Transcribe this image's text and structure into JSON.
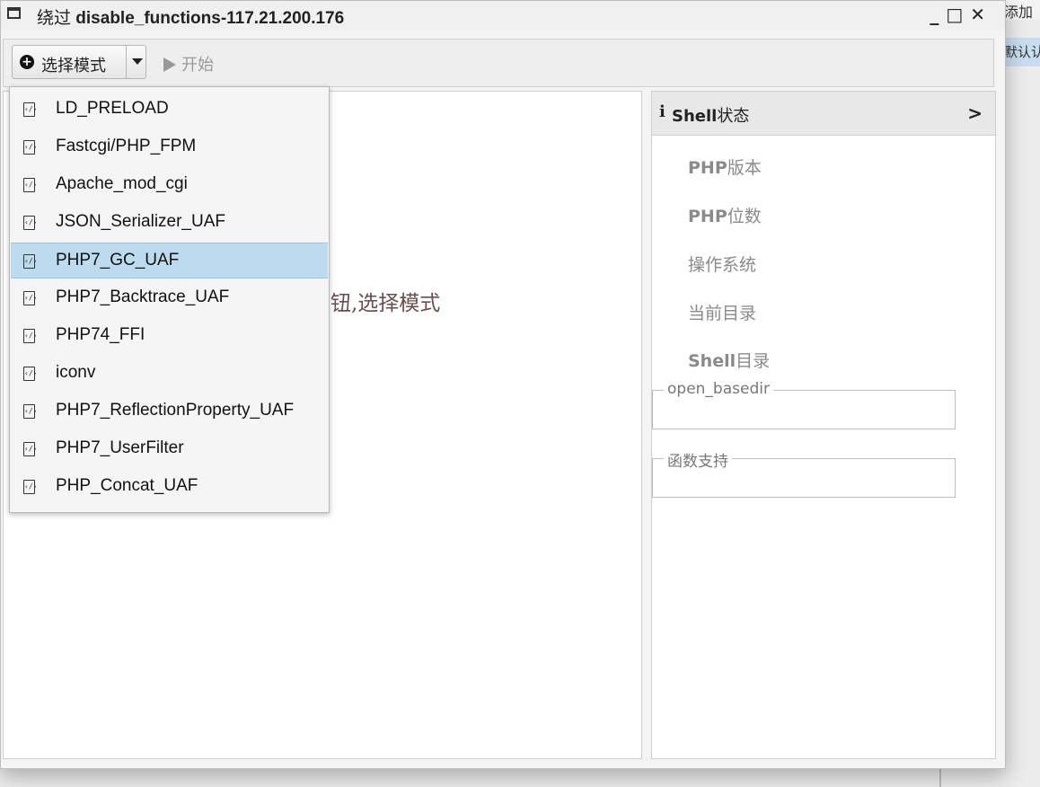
{
  "background": {
    "top_right_text": "添加",
    "tab_text": "默认认"
  },
  "window": {
    "title_prefix": "绕过",
    "title_highlight": "disable_functions-117.21.200.176",
    "controls": "_ □ ✕"
  },
  "toolbar": {
    "mode_label": "选择模式",
    "start_label": "开始"
  },
  "main": {
    "hint_text": "钮,选择模式"
  },
  "side": {
    "header_info": "i",
    "header_bold": "Shell",
    "header_rest": "状态",
    "chevron": ">",
    "items": [
      {
        "bold": "PHP",
        "rest": "版本"
      },
      {
        "bold": "PHP",
        "rest": "位数"
      },
      {
        "bold": "",
        "rest": "操作系统"
      },
      {
        "bold": "",
        "rest": "当前目录"
      },
      {
        "bold": "Shell",
        "rest": "目录"
      }
    ],
    "fieldsets": [
      {
        "legend": "open_basedir"
      },
      {
        "legend": "函数支持"
      }
    ]
  },
  "dropdown": {
    "selected_index": 4,
    "items": [
      "LD_PRELOAD",
      "Fastcgi/PHP_FPM",
      "Apache_mod_cgi",
      "JSON_Serializer_UAF",
      "PHP7_GC_UAF",
      "PHP7_Backtrace_UAF",
      "PHP74_FFI",
      "iconv",
      "PHP7_ReflectionProperty_UAF",
      "PHP7_UserFilter",
      "PHP_Concat_UAF"
    ]
  }
}
